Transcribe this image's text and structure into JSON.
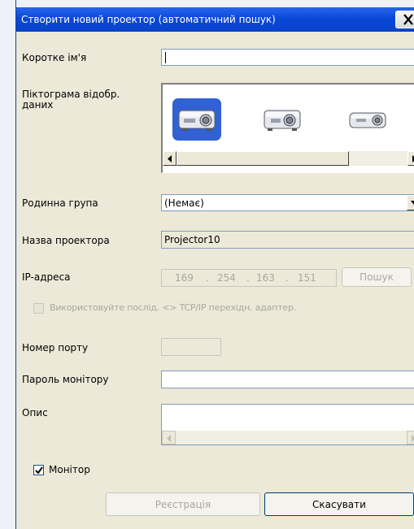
{
  "window": {
    "title": "Створити новий проектор (автоматичний пошук)"
  },
  "fields": {
    "short_name_label": "Коротке ім'я",
    "short_name_value": "",
    "icon_label": "Піктограма відобр. даних",
    "family_group_label": "Родинна група",
    "family_group_value": "(Немає)",
    "projector_name_label": "Назва проектора",
    "projector_name_value": "Projector10",
    "ip_label": "IP-адреса",
    "ip_octets": [
      "169",
      "254",
      "163",
      "151"
    ],
    "search_button": "Пошук",
    "tcpip_checkbox_label": "Використовуйте послід. <> TCP/IP перехідн. адаптер.",
    "tcpip_checked": false,
    "port_label": "Номер порту",
    "port_value": "",
    "monitor_password_label": "Пароль монітору",
    "monitor_password_value": "",
    "description_label": "Опис",
    "description_value": "",
    "monitor_checkbox_label": "Монітор",
    "monitor_checked": true
  },
  "icons": [
    {
      "name": "projector-icon-1",
      "selected": true
    },
    {
      "name": "projector-icon-2",
      "selected": false
    },
    {
      "name": "projector-icon-3",
      "selected": false
    }
  ],
  "buttons": {
    "register": "Реєстрація",
    "cancel": "Скасувати"
  },
  "colors": {
    "title_bar": "#0a48d8",
    "dialog_bg": "#ece9d8",
    "selected_icon_bg": "#3161d2",
    "disabled_text": "#a8a899"
  }
}
